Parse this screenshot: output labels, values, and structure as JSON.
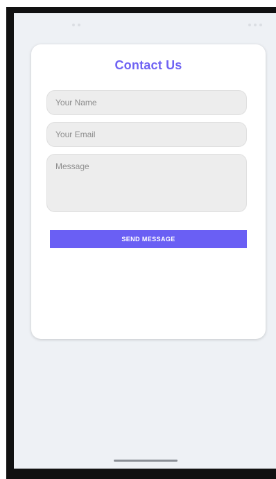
{
  "card": {
    "title": "Contact Us"
  },
  "form": {
    "name_placeholder": "Your Name",
    "email_placeholder": "Your Email",
    "message_placeholder": "Message",
    "send_label": "SEND MESSAGE"
  },
  "colors": {
    "accent": "#6a5ff4",
    "title": "#6f63f3",
    "screen_background": "#eef1f5",
    "field_background": "#ededed"
  }
}
